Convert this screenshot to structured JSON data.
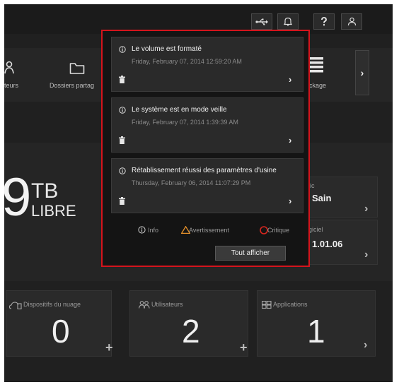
{
  "nav": {
    "items": [
      {
        "label": "teurs"
      },
      {
        "label": "Dossiers partag"
      },
      {
        "label": "ockage"
      }
    ]
  },
  "storage": {
    "value": "9",
    "unit": "TB",
    "free_label": "LIBRE"
  },
  "diagnostic": {
    "label": "stic",
    "value": "Sain"
  },
  "firmware": {
    "label": "ogiciel",
    "value": "1.01.06"
  },
  "cards": {
    "cloud": {
      "label": "Dispositifs du nuage",
      "value": "0"
    },
    "users": {
      "label": "Utilisateurs",
      "value": "2"
    },
    "apps": {
      "label": "Applications",
      "value": "1"
    }
  },
  "notifications": [
    {
      "title": "Le volume est formaté",
      "date": "Friday, February 07, 2014 12:59:20 AM"
    },
    {
      "title": "Le système est en mode veille",
      "date": "Friday, February 07, 2014 1:39:39 AM"
    },
    {
      "title": "Rétablissement réussi des paramètres d'usine",
      "date": "Thursday, February 06, 2014 11:07:29 PM"
    }
  ],
  "legend": {
    "info": "Info",
    "warning": "Avertissement",
    "critical": "Critique"
  },
  "view_all": "Tout afficher",
  "colors": {
    "highlight_border": "#d4141c",
    "warning": "#e8922a",
    "critical": "#d8261e"
  }
}
